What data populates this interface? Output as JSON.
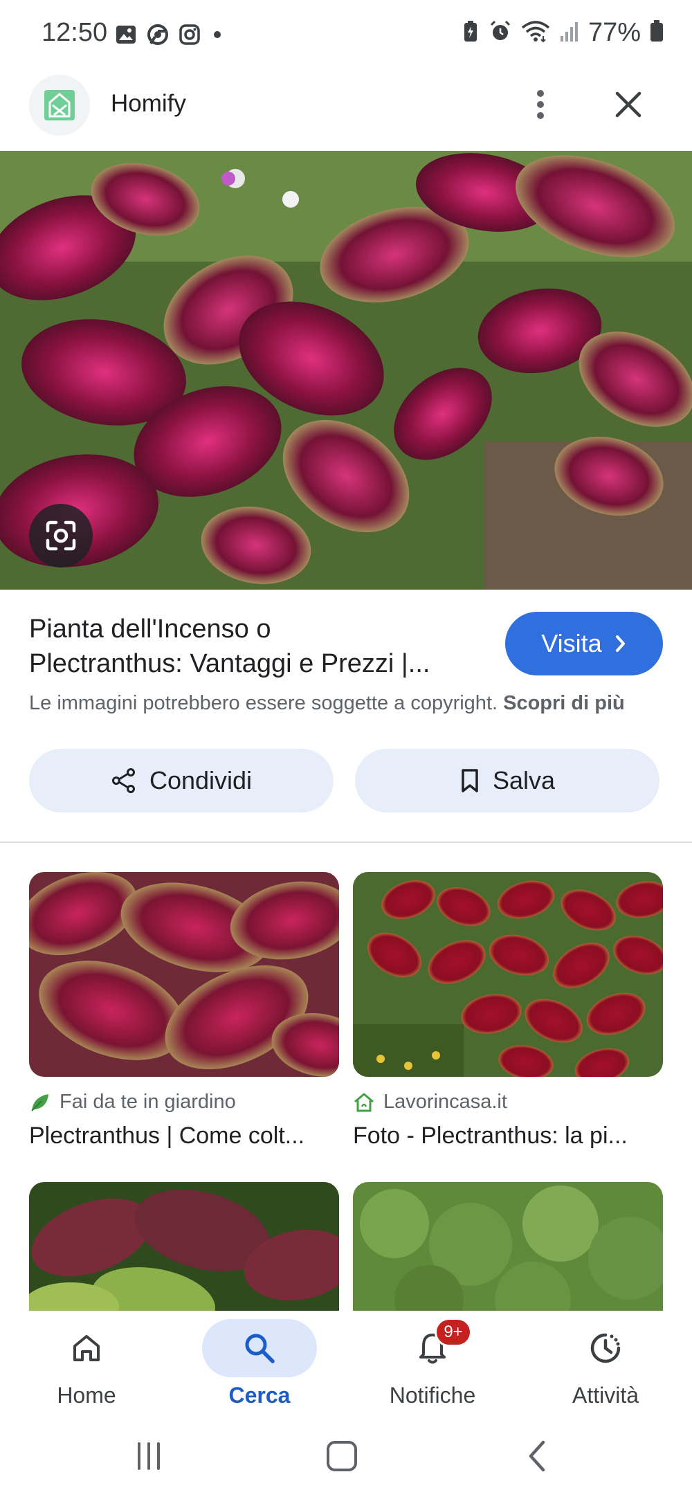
{
  "status_bar": {
    "time": "12:50",
    "left_icons": [
      "gallery-icon",
      "chrome-icon",
      "instagram-icon",
      "dot-icon"
    ],
    "right_icons": [
      "battery-saver-icon",
      "alarm-icon",
      "wifi-icon",
      "signal-icon"
    ],
    "battery_percent": "77%"
  },
  "header": {
    "site_name": "Homify",
    "menu_icon": "more-vert-icon",
    "close_icon": "close-icon"
  },
  "result": {
    "title_line1": "Pianta dell'Incenso o",
    "title_line2": "Plectranthus: Vantaggi e Prezzi |...",
    "visit_label": "Visita",
    "copyright_text": "Le immagini potrebbero essere soggette a copyright.",
    "copyright_link": "Scopri di più",
    "share_label": "Condividi",
    "save_label": "Salva"
  },
  "related": [
    {
      "source": "Fai da te in giardino",
      "title": "Plectranthus | Come colt..."
    },
    {
      "source": "Lavorincasa.it",
      "title": "Foto - Plectranthus: la pi..."
    }
  ],
  "bottom_nav": {
    "items": [
      {
        "label": "Home",
        "icon": "home-icon"
      },
      {
        "label": "Cerca",
        "icon": "search-icon"
      },
      {
        "label": "Notifiche",
        "icon": "bell-icon",
        "badge": "9+"
      },
      {
        "label": "Attività",
        "icon": "activity-icon"
      }
    ],
    "active": "Cerca"
  },
  "system_nav": [
    "recents-icon",
    "home-button-icon",
    "back-icon"
  ],
  "colors": {
    "accent": "#2f6fde",
    "active_nav": "#1a5cc8",
    "pill_bg": "#e8eef9",
    "badge": "#c5221f"
  }
}
